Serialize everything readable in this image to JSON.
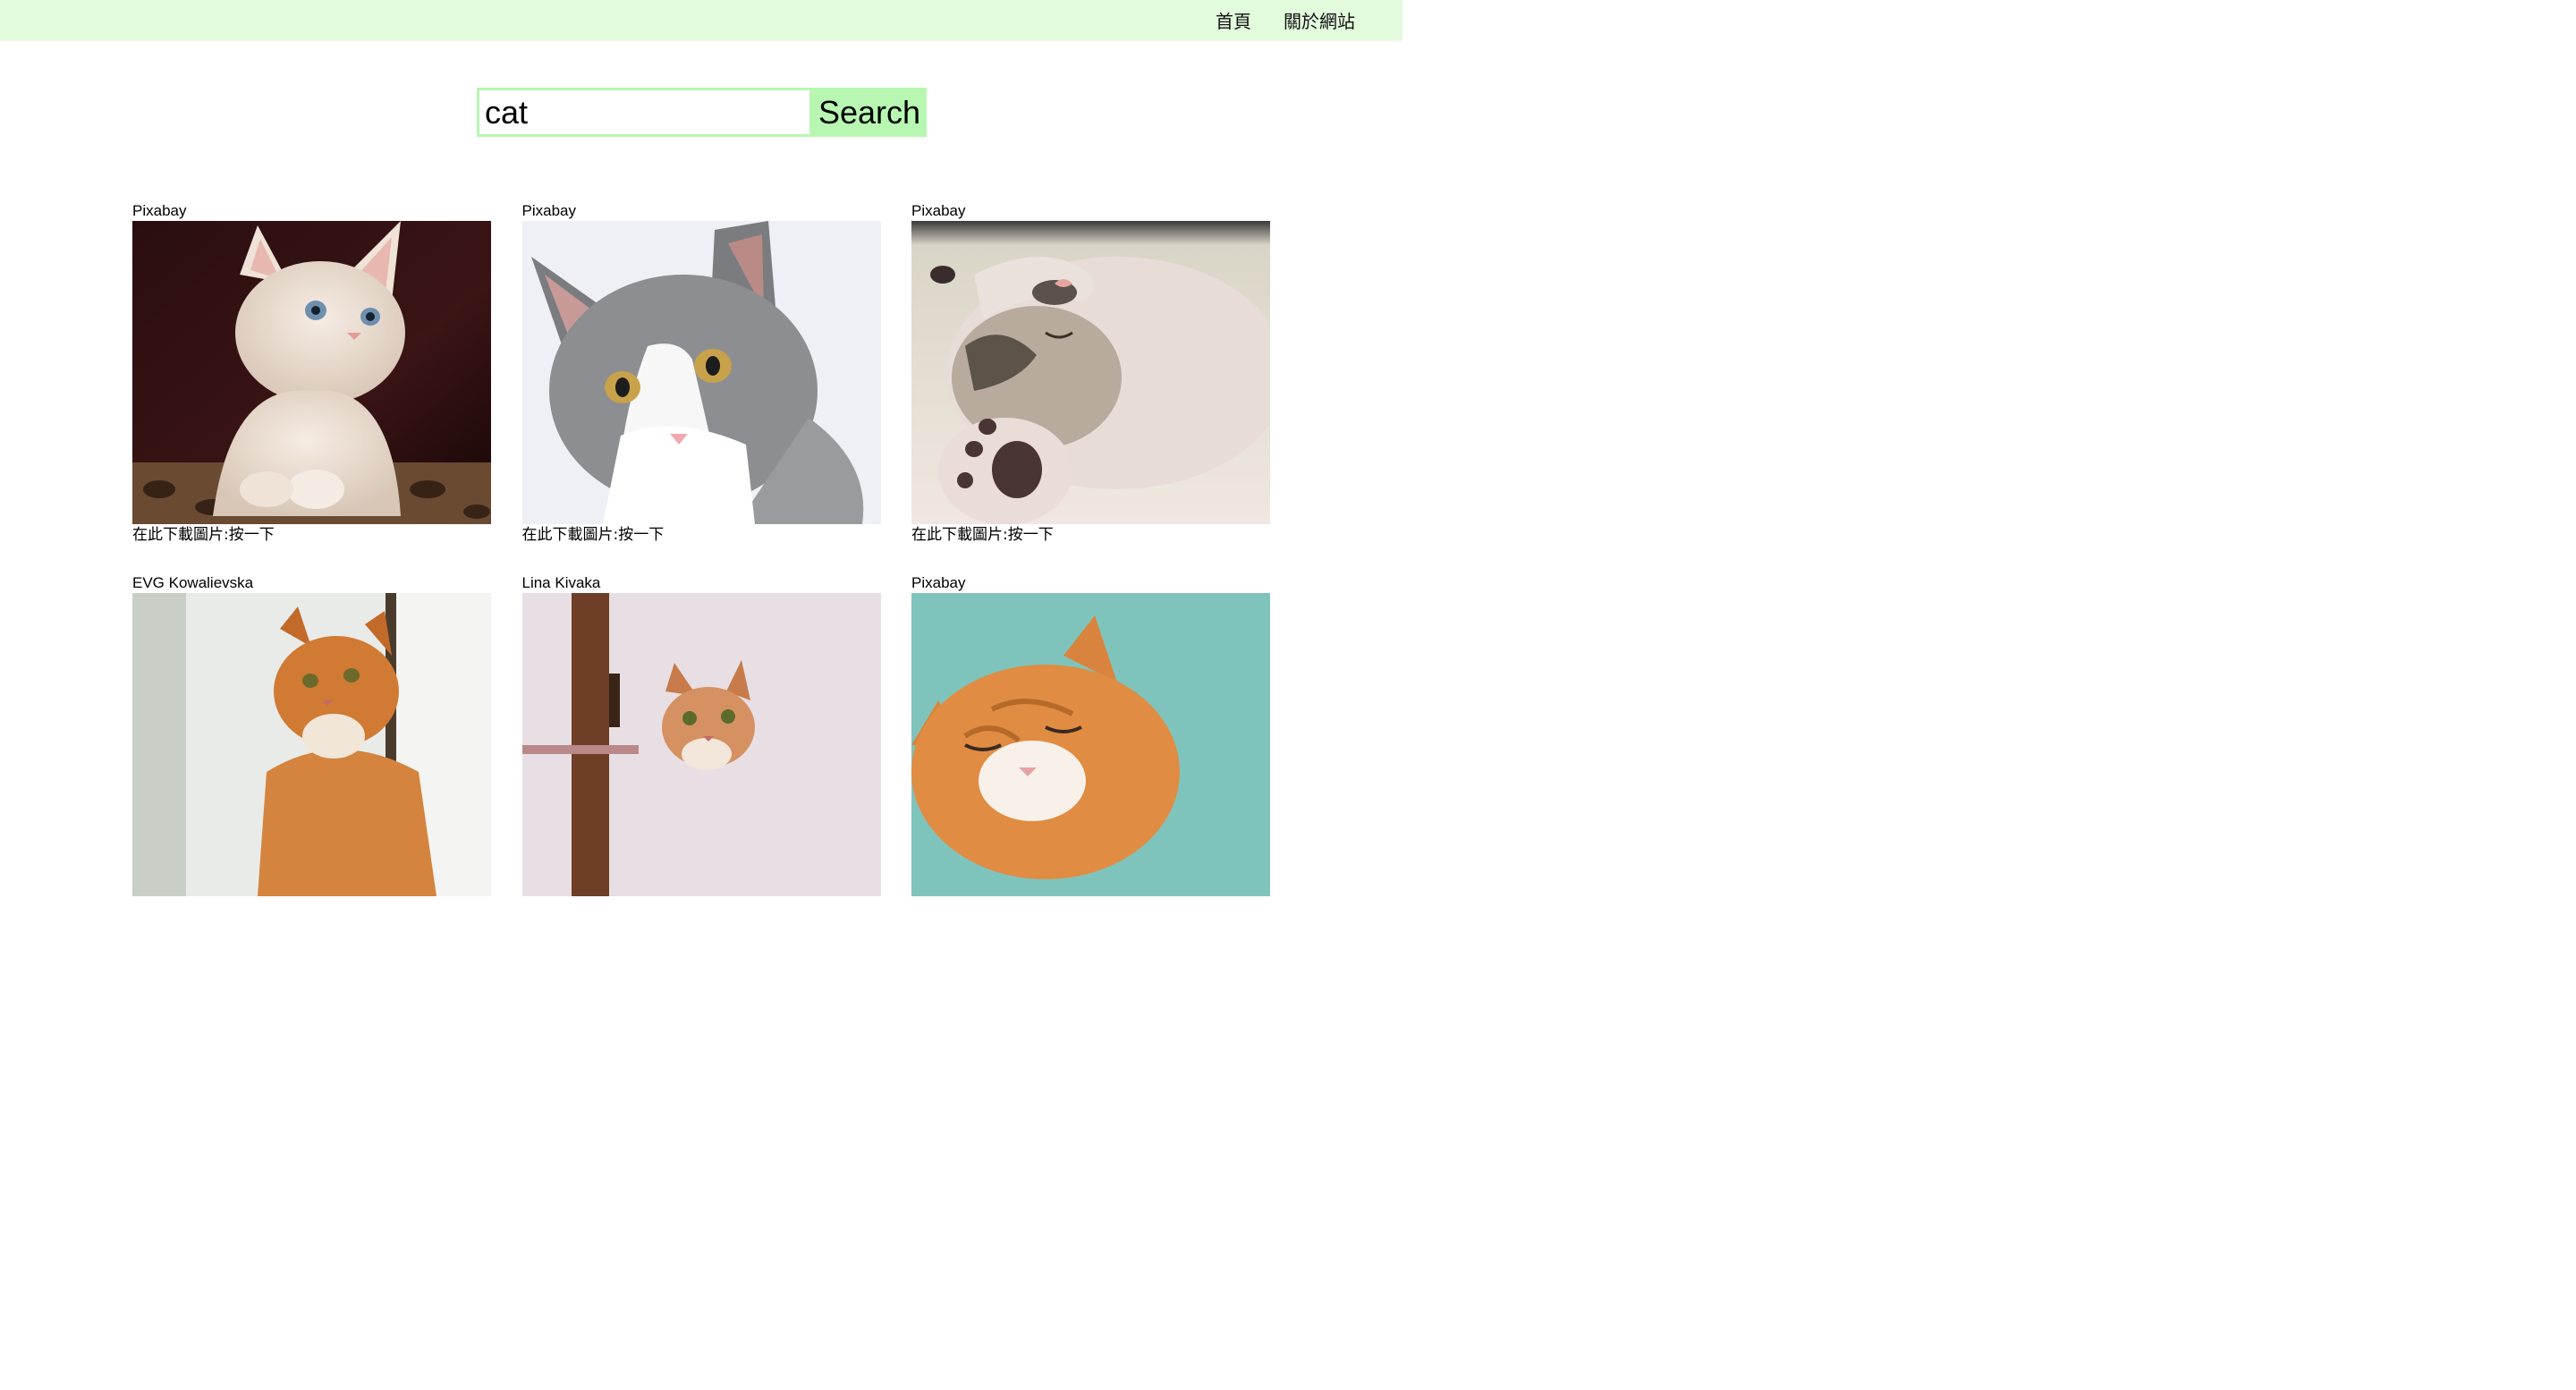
{
  "nav": {
    "items": [
      {
        "label": "首頁"
      },
      {
        "label": "關於網站"
      }
    ]
  },
  "search": {
    "value": "cat",
    "button_label": "Search"
  },
  "results": [
    {
      "photographer": "Pixabay",
      "download_label": "在此下載圖片:按一下",
      "image": "white-kitten-photo"
    },
    {
      "photographer": "Pixabay",
      "download_label": "在此下載圖片:按一下",
      "image": "gray-white-cat-photo"
    },
    {
      "photographer": "Pixabay",
      "download_label": "在此下載圖片:按一下",
      "image": "sleeping-kitten-photo"
    },
    {
      "photographer": "EVG Kowalievska",
      "download_label": "",
      "image": "orange-cat-window-photo"
    },
    {
      "photographer": "Lina Kivaka",
      "download_label": "",
      "image": "orange-kitten-photo"
    },
    {
      "photographer": "Pixabay",
      "download_label": "",
      "image": "orange-cat-teal-photo"
    }
  ],
  "colors": {
    "navbar": "#e2fbdc",
    "accent": "#b7f7b1"
  }
}
